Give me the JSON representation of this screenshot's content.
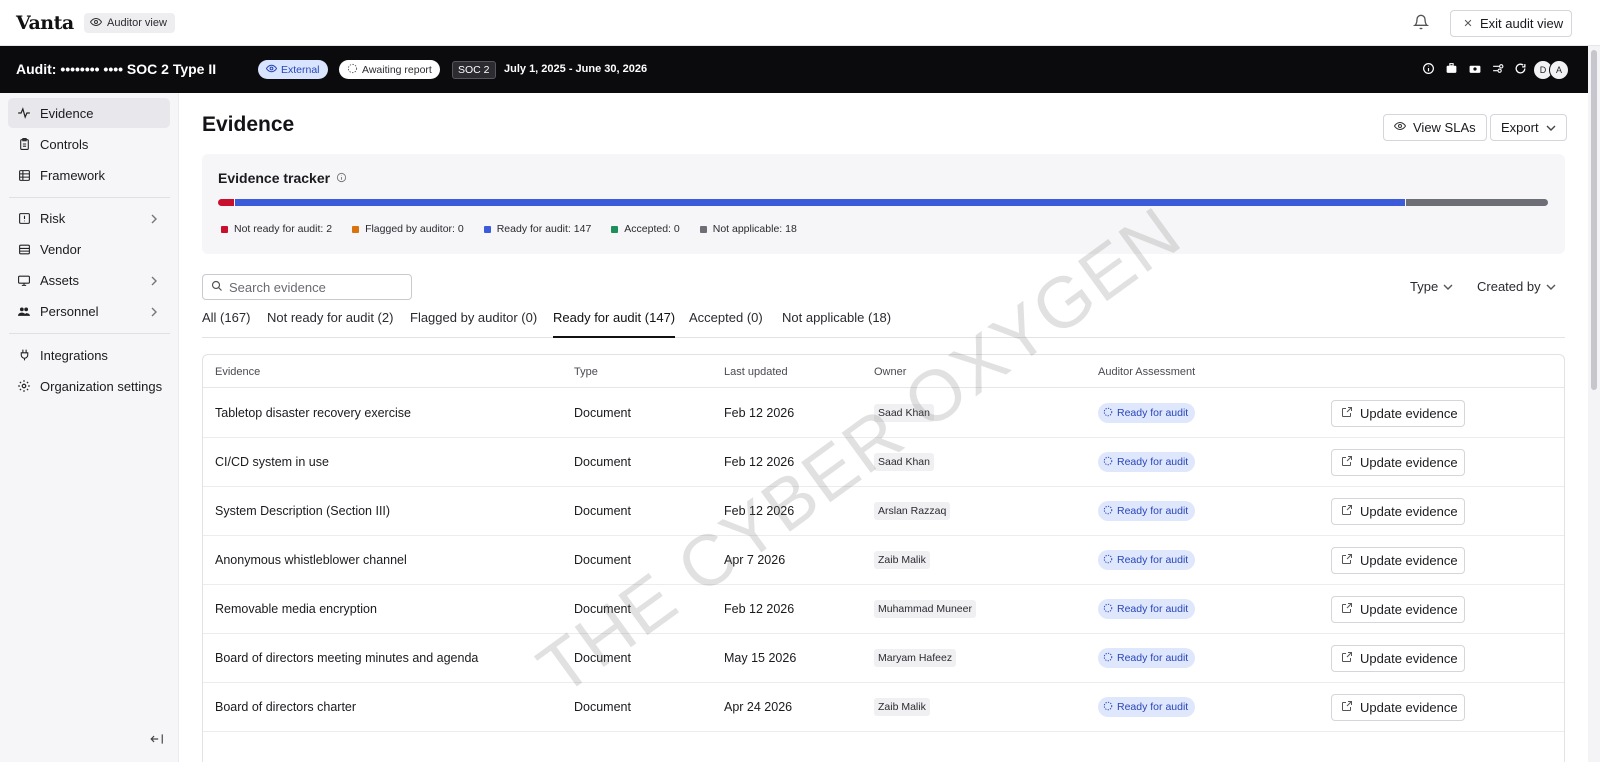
{
  "app": {
    "logo": "Vanta",
    "auditor_view_label": "Auditor view",
    "exit_label": "Exit audit view"
  },
  "audit": {
    "title": "Audit: •••••••• •••• SOC 2 Type II",
    "external_tag": "External",
    "awaiting_tag": "Awaiting report",
    "framework_tag": "SOC 2",
    "dates": "July 1, 2025 - June 30, 2026",
    "avatars": [
      "D",
      "A"
    ]
  },
  "sidebar": {
    "items": [
      {
        "label": "Evidence",
        "icon": "activity-icon"
      },
      {
        "label": "Controls",
        "icon": "clipboard-icon"
      },
      {
        "label": "Framework",
        "icon": "table-icon"
      },
      {
        "label": "Risk",
        "icon": "alert-square-icon"
      },
      {
        "label": "Vendor",
        "icon": "database-icon"
      },
      {
        "label": "Assets",
        "icon": "monitor-icon"
      },
      {
        "label": "Personnel",
        "icon": "users-icon"
      },
      {
        "label": "Integrations",
        "icon": "plug-icon"
      },
      {
        "label": "Organization settings",
        "icon": "gear-icon"
      }
    ]
  },
  "main": {
    "title": "Evidence",
    "view_slas": "View SLAs",
    "export": "Export",
    "tracker": {
      "title": "Evidence tracker",
      "segments": [
        {
          "label": "Not ready for audit: 2",
          "count": 2,
          "color": "#c8102e"
        },
        {
          "label": "Flagged by auditor: 0",
          "count": 0,
          "color": "#d9730d"
        },
        {
          "label": "Ready for audit: 147",
          "count": 147,
          "color": "#3b5bdb"
        },
        {
          "label": "Accepted: 0",
          "count": 0,
          "color": "#1e8e5a"
        },
        {
          "label": "Not applicable: 18",
          "count": 18,
          "color": "#6e6e76"
        }
      ]
    },
    "search_placeholder": "Search evidence",
    "filter_type": "Type",
    "filter_created_by": "Created by",
    "tabs": [
      "All (167)",
      "Not ready for audit (2)",
      "Flagged by auditor (0)",
      "Ready for audit (147)",
      "Accepted (0)",
      "Not applicable (18)"
    ],
    "table": {
      "headers": [
        "Evidence",
        "Type",
        "Last updated",
        "Owner",
        "Auditor Assessment"
      ],
      "action_label": "Update evidence",
      "rows": [
        {
          "evidence": "Tabletop disaster recovery exercise",
          "type": "Document",
          "updated": "Feb 12 2026",
          "owner": "Saad Khan",
          "status": "Ready for audit"
        },
        {
          "evidence": "CI/CD system in use",
          "type": "Document",
          "updated": "Feb 12 2026",
          "owner": "Saad Khan",
          "status": "Ready for audit"
        },
        {
          "evidence": "System Description (Section III)",
          "type": "Document",
          "updated": "Feb 12 2026",
          "owner": "Arslan Razzaq",
          "status": "Ready for audit"
        },
        {
          "evidence": "Anonymous whistleblower channel",
          "type": "Document",
          "updated": "Apr 7 2026",
          "owner": "Zaib Malik",
          "status": "Ready for audit"
        },
        {
          "evidence": "Removable media encryption",
          "type": "Document",
          "updated": "Feb 12 2026",
          "owner": "Muhammad Muneer",
          "status": "Ready for audit"
        },
        {
          "evidence": "Board of directors meeting minutes and agenda",
          "type": "Document",
          "updated": "May 15 2026",
          "owner": "Maryam Hafeez",
          "status": "Ready for audit"
        },
        {
          "evidence": "Board of directors charter",
          "type": "Document",
          "updated": "Apr 24 2026",
          "owner": "Zaib Malik",
          "status": "Ready for audit"
        }
      ]
    }
  },
  "watermark": "THE CYBER OXYGEN"
}
